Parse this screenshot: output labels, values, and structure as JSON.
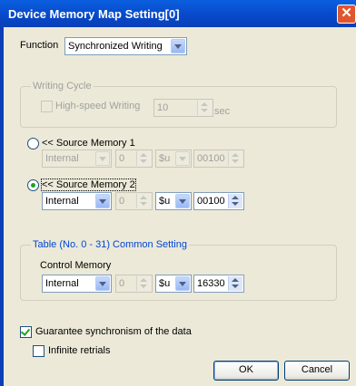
{
  "window": {
    "title": "Device Memory Map Setting[0]",
    "close_glyph": "✕"
  },
  "function": {
    "label": "Function",
    "value": "Synchronized Writing"
  },
  "writing_cycle": {
    "title": "Writing Cycle",
    "high_speed_label": "High-speed Writing",
    "value": "10",
    "unit": "sec"
  },
  "source1": {
    "label": "<< Source Memory 1",
    "memory": "Internal",
    "num": "0",
    "type": "$u",
    "address": "00100"
  },
  "source2": {
    "label": "<< Source Memory 2",
    "memory": "Internal",
    "num": "0",
    "type": "$u",
    "address": "00100"
  },
  "table": {
    "title": "Table (No. 0 - 31) Common Setting",
    "control_label": "Control Memory",
    "memory": "Internal",
    "num": "0",
    "type": "$u",
    "address": "16330"
  },
  "guarantee_label": "Guarantee synchronism of the data",
  "infinite_label": "Infinite retrials",
  "buttons": {
    "ok": "OK",
    "cancel": "Cancel"
  },
  "colors": {
    "title_bar": "#0748C8",
    "dialog_bg": "#ECE9D8",
    "group_title": "#0046D5",
    "check_mark": "#21A121"
  }
}
